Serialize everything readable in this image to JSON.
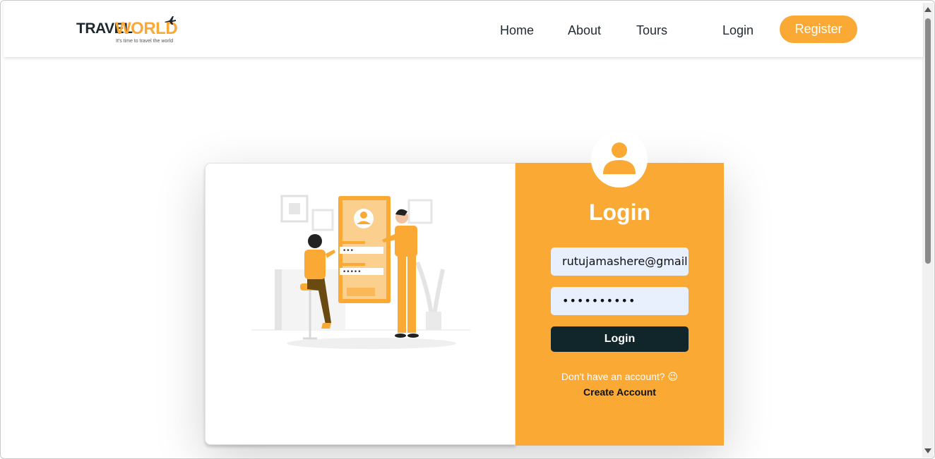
{
  "header": {
    "logo": {
      "brand_part1": "TRAVEL",
      "brand_part2": "WORLD",
      "tagline": "It's time to travel the world"
    },
    "nav": [
      {
        "label": "Home"
      },
      {
        "label": "About"
      },
      {
        "label": "Tours"
      }
    ],
    "login_label": "Login",
    "register_label": "Register"
  },
  "login": {
    "title": "Login",
    "email_value": "rutujamashere@gmail.com",
    "password_value": "••••••••••",
    "submit_label": "Login",
    "no_account_text": "Don't have an account? 😉",
    "create_account_label": "Create Account"
  },
  "icons": {
    "avatar": "user-icon",
    "plane": "plane-icon",
    "illustration": "login-illustration"
  },
  "colors": {
    "accent": "#faa935",
    "dark": "#10262a",
    "input_bg": "#e8f0fe",
    "heading": "#1f2a30"
  }
}
